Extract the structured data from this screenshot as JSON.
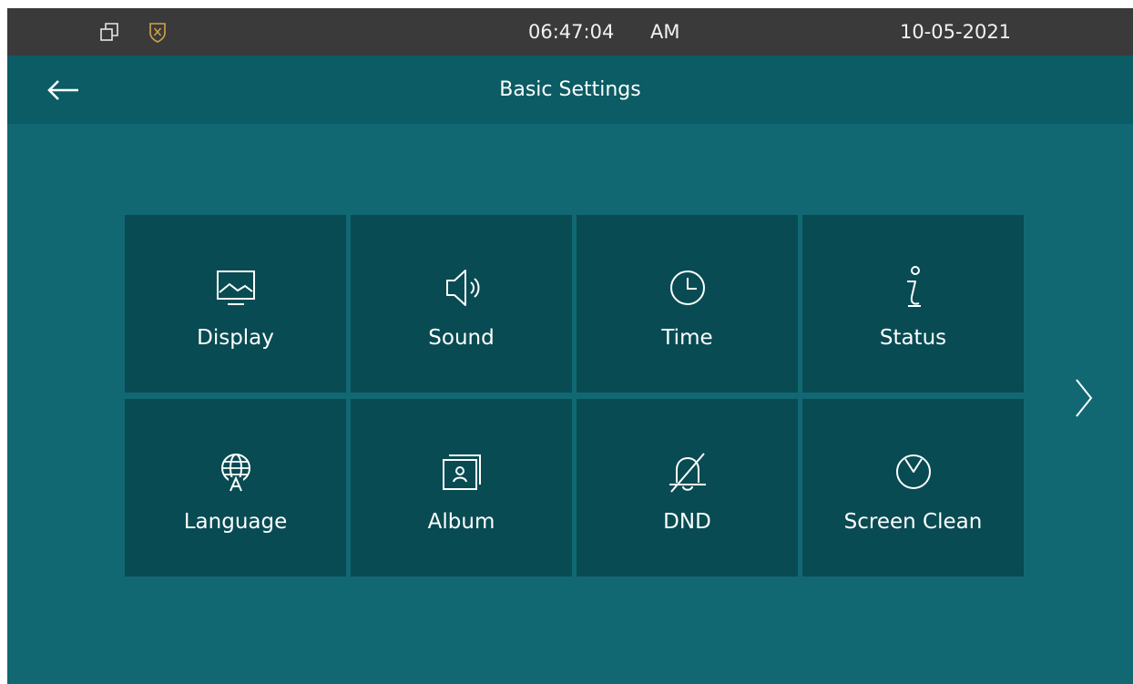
{
  "status_bar": {
    "time": "06:47:04",
    "period": "AM",
    "date": "10-05-2021",
    "icons": [
      "window-icon",
      "shield-icon"
    ]
  },
  "header": {
    "title": "Basic Settings",
    "back_icon": "arrow-left-icon"
  },
  "tiles": [
    {
      "label": "Display",
      "icon": "display-icon"
    },
    {
      "label": "Sound",
      "icon": "speaker-icon"
    },
    {
      "label": "Time",
      "icon": "clock-icon"
    },
    {
      "label": "Status",
      "icon": "info-icon"
    },
    {
      "label": "Language",
      "icon": "globe-icon"
    },
    {
      "label": "Album",
      "icon": "album-icon"
    },
    {
      "label": "DND",
      "icon": "bell-off-icon"
    },
    {
      "label": "Screen Clean",
      "icon": "timer-icon"
    }
  ],
  "pager": {
    "next_icon": "chevron-right-icon"
  },
  "colors": {
    "background": "#116873",
    "header": "#0b5c64",
    "tile": "#084b53",
    "status_bar": "#3a3a3a",
    "shield": "#d3a24a"
  }
}
